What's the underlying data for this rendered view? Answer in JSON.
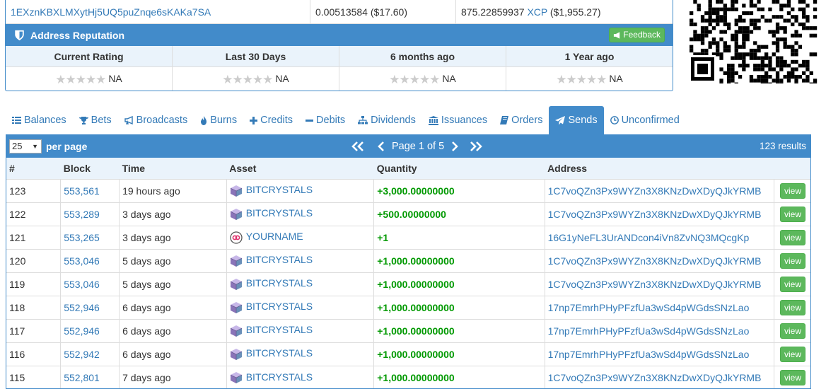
{
  "balance_row": {
    "address": "1EXznKBXLMXytHj5UQ5puZnqe6sKAKa7SA",
    "btc": "0.00513584 ($17.60)",
    "xcp_amount": "875.22859937",
    "xcp_asset": "XCP",
    "xcp_usd": "($1,955.27)"
  },
  "reputation": {
    "title": "Address Reputation",
    "feedback_label": "Feedback",
    "columns": [
      {
        "label": "Current Rating",
        "value": "NA",
        "stars": 0
      },
      {
        "label": "Last 30 Days",
        "value": "NA",
        "stars": 0
      },
      {
        "label": "6 months ago",
        "value": "NA",
        "stars": 0
      },
      {
        "label": "1 Year ago",
        "value": "NA",
        "stars": 0
      }
    ]
  },
  "tabs": [
    {
      "label": "Balances",
      "icon": "list-icon"
    },
    {
      "label": "Bets",
      "icon": "trophy-icon"
    },
    {
      "label": "Broadcasts",
      "icon": "bullhorn-icon"
    },
    {
      "label": "Burns",
      "icon": "fire-icon"
    },
    {
      "label": "Credits",
      "icon": "plus-icon"
    },
    {
      "label": "Debits",
      "icon": "minus-icon"
    },
    {
      "label": "Dividends",
      "icon": "sitemap-icon"
    },
    {
      "label": "Issuances",
      "icon": "bank-icon"
    },
    {
      "label": "Orders",
      "icon": "book-icon"
    },
    {
      "label": "Sends",
      "icon": "send-icon",
      "active": true
    },
    {
      "label": "Unconfirmed",
      "icon": "clock-icon"
    }
  ],
  "results": {
    "per_page_value": "25",
    "per_page_label": "per page",
    "page_info": "Page 1 of 5",
    "count": "123 results",
    "view_label": "view",
    "columns": [
      "#",
      "Block",
      "Time",
      "Asset",
      "Quantity",
      "Address"
    ],
    "rows": [
      {
        "n": "123",
        "block": "553,561",
        "time": "19 hours ago",
        "asset": "BITCRYSTALS",
        "icon": "cube",
        "qty": "+3,000.00000000",
        "address": "1C7voQZn3Px9WYZn3X8KNzDwXDyQJkYRMB"
      },
      {
        "n": "122",
        "block": "553,289",
        "time": "3 days ago",
        "asset": "BITCRYSTALS",
        "icon": "cube",
        "qty": "+500.00000000",
        "address": "1C7voQZn3Px9WYZn3X8KNzDwXDyQJkYRMB"
      },
      {
        "n": "121",
        "block": "553,265",
        "time": "3 days ago",
        "asset": "YOURNAME",
        "icon": "ring",
        "qty": "+1",
        "address": "16G1yNeFL3UrANDcon4iVn8ZvNQ3MQcgKp"
      },
      {
        "n": "120",
        "block": "553,046",
        "time": "5 days ago",
        "asset": "BITCRYSTALS",
        "icon": "cube",
        "qty": "+1,000.00000000",
        "address": "1C7voQZn3Px9WYZn3X8KNzDwXDyQJkYRMB"
      },
      {
        "n": "119",
        "block": "553,046",
        "time": "5 days ago",
        "asset": "BITCRYSTALS",
        "icon": "cube",
        "qty": "+1,000.00000000",
        "address": "1C7voQZn3Px9WYZn3X8KNzDwXDyQJkYRMB"
      },
      {
        "n": "118",
        "block": "552,946",
        "time": "6 days ago",
        "asset": "BITCRYSTALS",
        "icon": "cube",
        "qty": "+1,000.00000000",
        "address": "17np7EmrhPHyPFzfUa3wSd4pWGdsSNzLao"
      },
      {
        "n": "117",
        "block": "552,946",
        "time": "6 days ago",
        "asset": "BITCRYSTALS",
        "icon": "cube",
        "qty": "+1,000.00000000",
        "address": "17np7EmrhPHyPFzfUa3wSd4pWGdsSNzLao"
      },
      {
        "n": "116",
        "block": "552,942",
        "time": "6 days ago",
        "asset": "BITCRYSTALS",
        "icon": "cube",
        "qty": "+1,000.00000000",
        "address": "17np7EmrhPHyPFzfUa3wSd4pWGdsSNzLao"
      },
      {
        "n": "115",
        "block": "552,801",
        "time": "7 days ago",
        "asset": "BITCRYSTALS",
        "icon": "cube",
        "qty": "+1,000.00000000",
        "address": "1C7voQZn3Px9WYZn3X8KNzDwXDyQJkYRMB"
      }
    ]
  },
  "colors": {
    "primary": "#428bca",
    "success": "#5cb85c",
    "positive_qty": "#009900",
    "link": "#337ab7"
  }
}
